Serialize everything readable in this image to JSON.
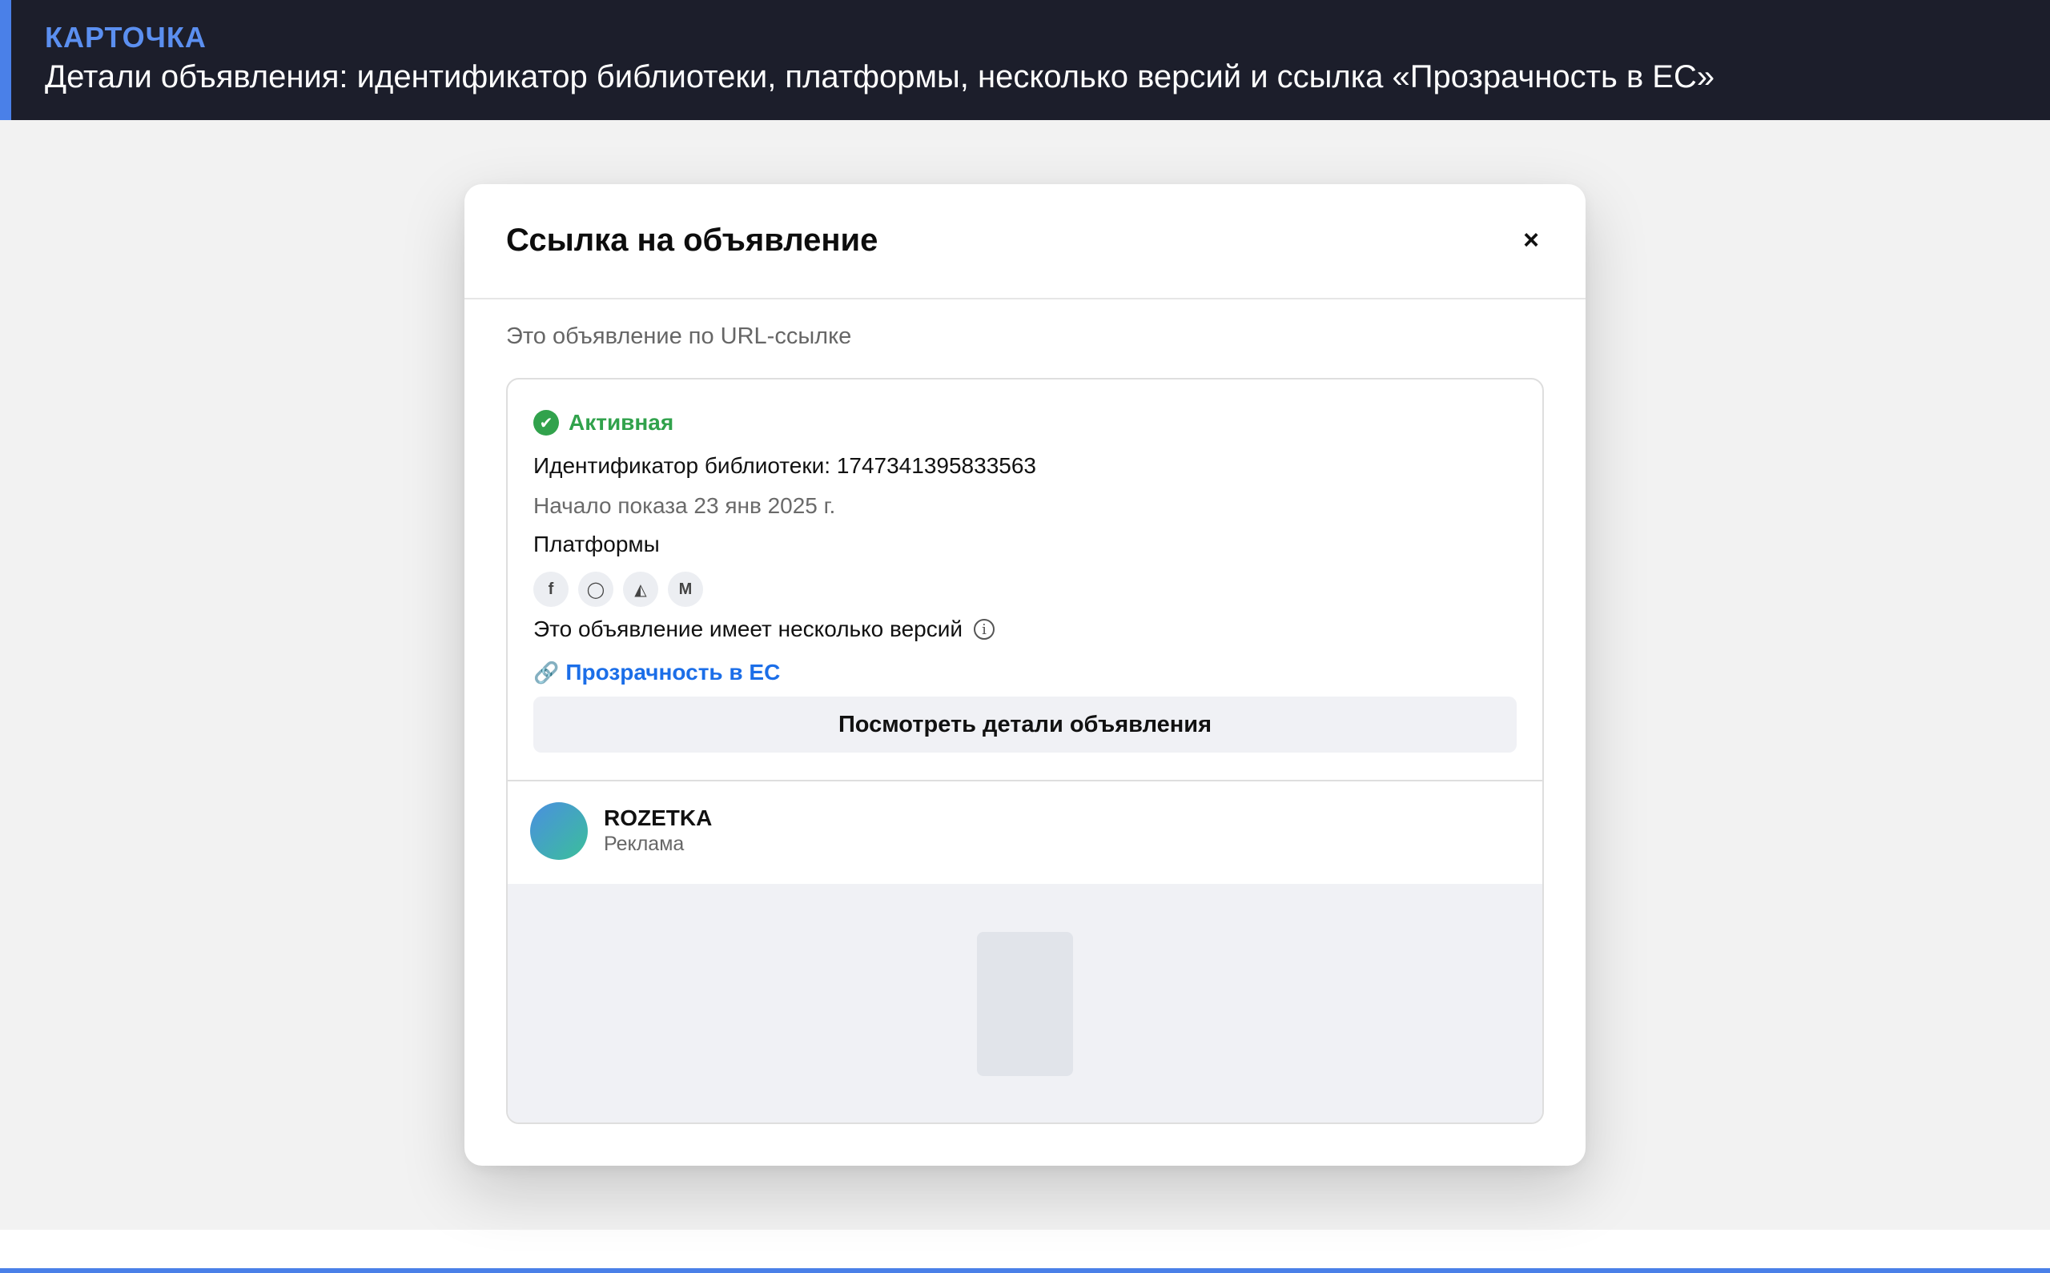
{
  "header": {
    "kicker": "КАРТОЧКА",
    "headline": "Детали объявления: идентификатор библиотеки, платформы, несколько версий и ссылка «Прозрачность в ЕС»"
  },
  "modal": {
    "title": "Ссылка на объявление",
    "close_label": "×",
    "subtitle": "Это объявление по URL-ссылке"
  },
  "card": {
    "status": {
      "icon": "check-circle-icon",
      "icon_glyph": "✔",
      "label": "Активная",
      "color": "#31a24c"
    },
    "library_id": "Идентификатор библиотеки: 1747341395833563",
    "start_date": "Начало показа 23 янв 2025 г.",
    "platforms_label": "Платформы",
    "platforms": [
      {
        "name": "facebook-icon",
        "glyph": "f"
      },
      {
        "name": "instagram-icon",
        "glyph": "◯"
      },
      {
        "name": "audience-network-icon",
        "glyph": "◭"
      },
      {
        "name": "messenger-icon",
        "glyph": "M"
      }
    ],
    "versions_text": "Это объявление имеет несколько версий",
    "info_glyph": "i",
    "link_glyph": "🔗",
    "eu_link_label": "Прозрачность в ЕС",
    "details_button": "Посмотреть детали объявления"
  },
  "advertiser": {
    "name": "ROZETKA",
    "label": "Реклама"
  },
  "colors": {
    "accent": "#4a80e8",
    "link": "#1b6ee8",
    "header_bg": "#1c1e2b"
  }
}
